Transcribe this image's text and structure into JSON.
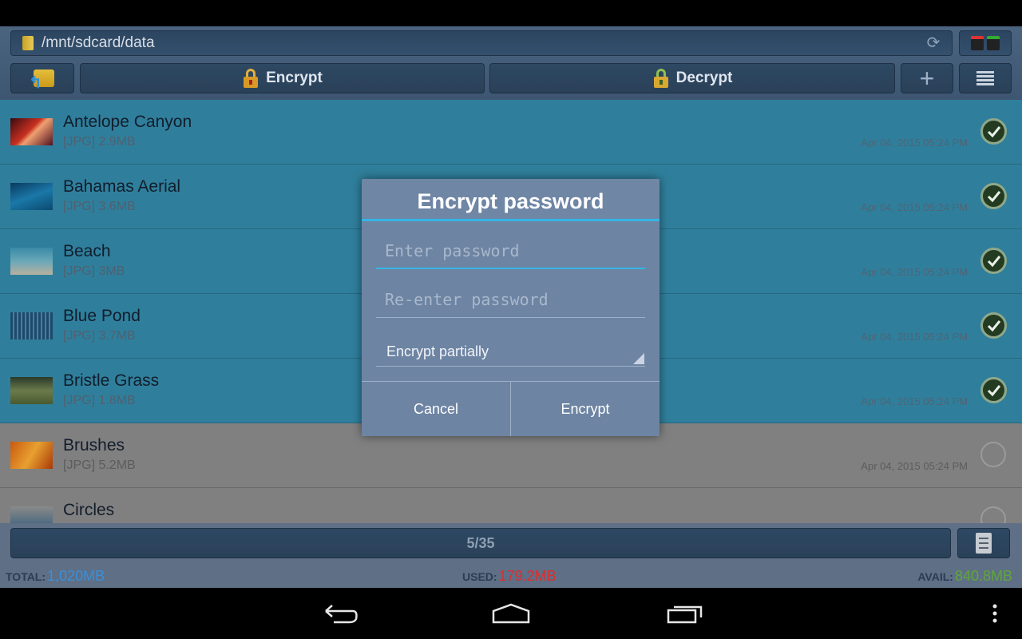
{
  "toolbar": {
    "path": "/mnt/sdcard/data",
    "encrypt_label": "Encrypt",
    "decrypt_label": "Decrypt"
  },
  "files": [
    {
      "name": "Antelope Canyon",
      "meta": "[JPG]  2.9MB",
      "date": "Apr 04, 2015 05:24 PM",
      "selected": true
    },
    {
      "name": "Bahamas Aerial",
      "meta": "[JPG]  3.6MB",
      "date": "Apr 04, 2015 05:24 PM",
      "selected": true
    },
    {
      "name": "Beach",
      "meta": "[JPG]  3MB",
      "date": "Apr 04, 2015 05:24 PM",
      "selected": true
    },
    {
      "name": "Blue Pond",
      "meta": "[JPG]  3.7MB",
      "date": "Apr 04, 2015 05:24 PM",
      "selected": true
    },
    {
      "name": "Bristle Grass",
      "meta": "[JPG]  1.8MB",
      "date": "Apr 04, 2015 05:24 PM",
      "selected": true
    },
    {
      "name": "Brushes",
      "meta": "[JPG]  5.2MB",
      "date": "Apr 04, 2015 05:24 PM",
      "selected": false
    },
    {
      "name": "Circles",
      "meta": "",
      "date": "",
      "selected": false
    }
  ],
  "footer": {
    "progress": "5/35",
    "total_label": "TOTAL:",
    "total_value": "1,020MB",
    "used_label": "USED:",
    "used_value": "179.2MB",
    "avail_label": "AVAIL:",
    "avail_value": "840.8MB"
  },
  "dialog": {
    "title": "Encrypt password",
    "password_placeholder": "Enter password",
    "repeat_placeholder": "Re-enter password",
    "mode": "Encrypt partially",
    "cancel_label": "Cancel",
    "confirm_label": "Encrypt"
  },
  "colors": {
    "accent": "#35b5e5",
    "selected_row": "#2f7f9c",
    "total_value": "#3a8fd8",
    "used_value": "#d83030",
    "avail_value": "#5fa63a"
  }
}
